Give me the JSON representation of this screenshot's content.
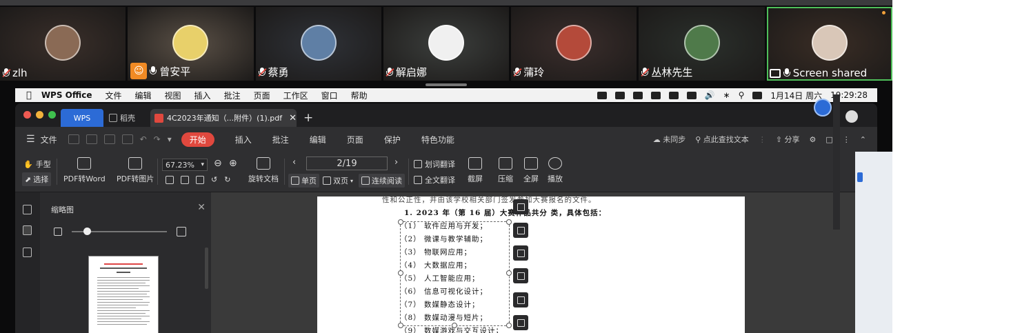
{
  "meeting": {
    "tiles": [
      {
        "name": "zlh",
        "muted": true,
        "bg": "#3a2f2a",
        "avatar_color": "#8a6a55"
      },
      {
        "name": "曾安平",
        "muted": false,
        "has_person_badge": true,
        "bg": "#5a5046",
        "avatar_color": "#e8d06a"
      },
      {
        "name": "蔡勇",
        "muted": true,
        "bg": "#2f3238",
        "avatar_color": "#5f7fa5"
      },
      {
        "name": "解启娜",
        "muted": true,
        "bg": "#3c3f3d",
        "avatar_color": "#f0f0f0"
      },
      {
        "name": "蒲玲",
        "muted": true,
        "bg": "#3b2e2c",
        "avatar_color": "#b44a3a"
      },
      {
        "name": "丛林先生",
        "muted": true,
        "bg": "#2b302c",
        "avatar_color": "#4f7a4a"
      },
      {
        "name": "Screen shared",
        "muted": false,
        "sharing": true,
        "active": true,
        "bg": "#3a2d25",
        "avatar_color": "#d9c7b8"
      }
    ]
  },
  "menubar": {
    "app_name": "WPS Office",
    "items": [
      "文件",
      "编辑",
      "视图",
      "插入",
      "批注",
      "页面",
      "工作区",
      "窗口",
      "帮助"
    ],
    "date": "1月14日 周六",
    "time": "19:29:28"
  },
  "wps": {
    "tabs": {
      "wps": "WPS",
      "daoke": "稻壳",
      "doc": "4C2023年通知（...附件）(1).pdf"
    },
    "menu": {
      "file": "文件",
      "start": "开始",
      "items": [
        "插入",
        "批注",
        "编辑",
        "页面",
        "保护",
        "特色功能"
      ],
      "sync": "未同步",
      "search_placeholder": "点此查找文本",
      "share": "分享"
    },
    "toolbar": {
      "hand": "手型",
      "select": "选择",
      "pdf_to_word": "PDF转Word",
      "pdf_to_image": "PDF转图片",
      "zoom": "67.23%",
      "rotate_doc": "旋转文档",
      "page": "2/19",
      "single": "单页",
      "double": "双页",
      "continuous": "连续阅读",
      "word_translate": "划词翻译",
      "full_translate": "全文翻译",
      "screenshot": "截屏",
      "compress": "压缩",
      "fullscreen": "全屏",
      "play": "播放"
    },
    "thumbnail_panel": {
      "title": "缩略图",
      "zoom_level": 0.16
    },
    "document": {
      "line0": "性和公正性，并由该学校相关部门签发参加大赛报名的文件。",
      "heading": "1. 2023 年（第 16 届）大赛作品共分    类，具体包括：",
      "items": [
        "（1） 软件应用与开发；",
        "（2） 微课与教学辅助；",
        "（3） 物联网应用；",
        "（4） 大数据应用；",
        "（5） 人工智能应用；",
        "（6） 信息可视化设计；",
        "（7） 数媒静态设计；",
        "（8） 数媒动漫与短片；",
        "（9） 数媒游戏与交互设计；"
      ]
    }
  }
}
